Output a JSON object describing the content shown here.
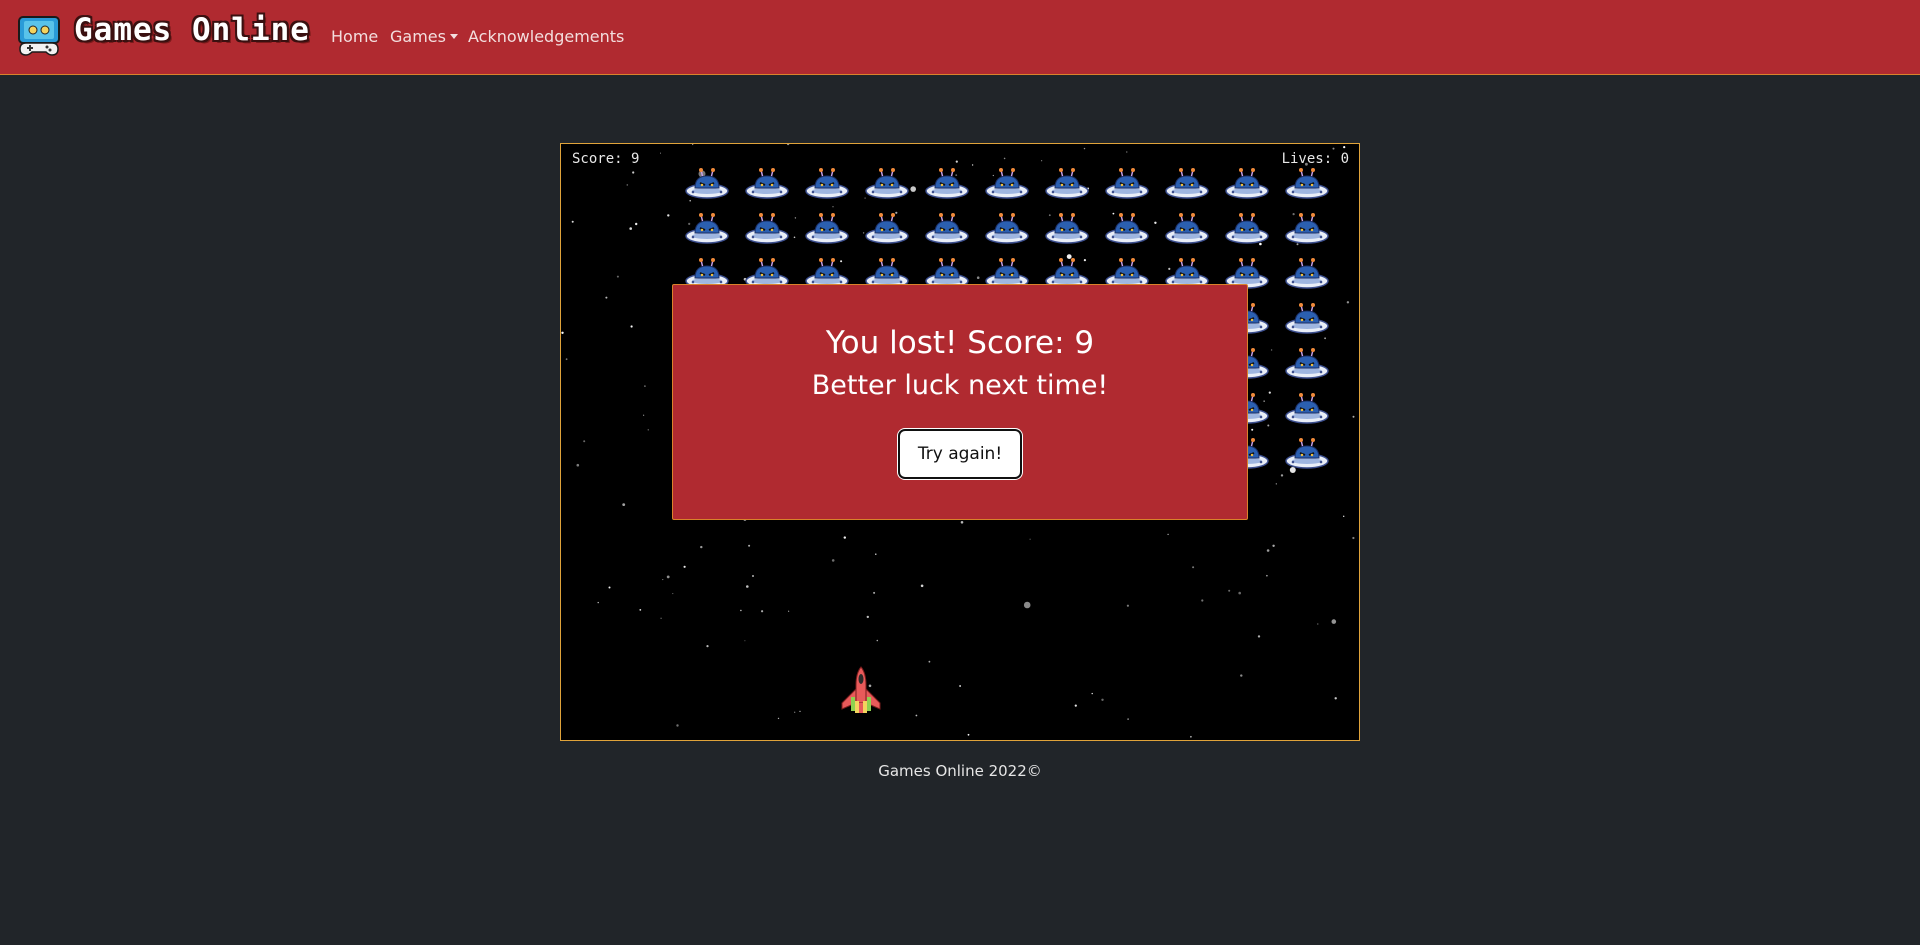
{
  "navbar": {
    "brand": "Games Online",
    "links": [
      {
        "label": "Home"
      },
      {
        "label": "Games",
        "dropdown": true
      },
      {
        "label": "Acknowledgements"
      }
    ],
    "colors": {
      "background": "#b02a30",
      "border": "#d9822b"
    }
  },
  "game": {
    "hud": {
      "score_label": "Score: 9",
      "lives_label": "Lives: 0"
    },
    "invaders_grid": {
      "columns": 11,
      "rows": 7
    },
    "icons": {
      "invader": "ufo-alien-icon",
      "player": "spaceship-icon"
    }
  },
  "modal": {
    "title": "You lost! Score: 9",
    "subtitle": "Better luck next time!",
    "button_label": "Try again!"
  },
  "footer": {
    "text": "Games Online 2022©"
  },
  "colors": {
    "page_background": "#212529",
    "accent_border": "#e0a33a"
  }
}
